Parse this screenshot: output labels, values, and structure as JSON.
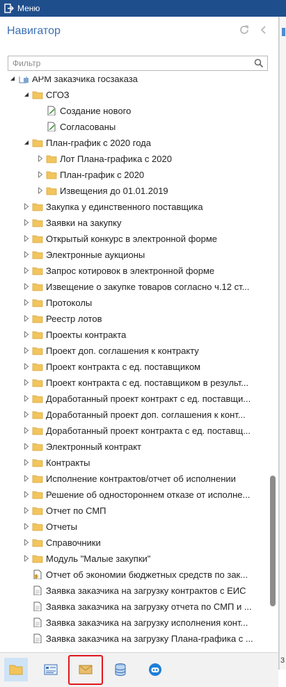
{
  "window": {
    "title": "Меню"
  },
  "navigator": {
    "title": "Навигатор",
    "filter_placeholder": "Фильтр"
  },
  "tree": [
    {
      "label": "АРМ заказчика госзаказа",
      "level": 0,
      "icon": "doc-folder",
      "expander": "expanded"
    },
    {
      "label": "СГОЗ",
      "level": 1,
      "icon": "folder",
      "expander": "expanded"
    },
    {
      "label": "Создание нового",
      "level": 2,
      "icon": "document-edit",
      "expander": "none"
    },
    {
      "label": "Согласованы",
      "level": 2,
      "icon": "document-edit",
      "expander": "none"
    },
    {
      "label": "План-график с 2020 года",
      "level": 1,
      "icon": "folder",
      "expander": "expanded"
    },
    {
      "label": "Лот Плана-графика с 2020",
      "level": 2,
      "icon": "folder",
      "expander": "collapsed"
    },
    {
      "label": "План-график с 2020",
      "level": 2,
      "icon": "folder",
      "expander": "collapsed"
    },
    {
      "label": "Извещения до 01.01.2019",
      "level": 2,
      "icon": "folder",
      "expander": "collapsed"
    },
    {
      "label": "Закупка у единственного поставщика",
      "level": 1,
      "icon": "folder",
      "expander": "collapsed"
    },
    {
      "label": "Заявки на закупку",
      "level": 1,
      "icon": "folder",
      "expander": "collapsed"
    },
    {
      "label": "Открытый конкурс в электронной форме",
      "level": 1,
      "icon": "folder",
      "expander": "collapsed"
    },
    {
      "label": "Электронные аукционы",
      "level": 1,
      "icon": "folder",
      "expander": "collapsed"
    },
    {
      "label": "Запрос котировок в электронной форме",
      "level": 1,
      "icon": "folder",
      "expander": "collapsed"
    },
    {
      "label": "Извещение о закупке товаров согласно ч.12 ст...",
      "level": 1,
      "icon": "folder",
      "expander": "collapsed"
    },
    {
      "label": "Протоколы",
      "level": 1,
      "icon": "folder",
      "expander": "collapsed"
    },
    {
      "label": "Реестр лотов",
      "level": 1,
      "icon": "folder",
      "expander": "collapsed"
    },
    {
      "label": "Проекты контракта",
      "level": 1,
      "icon": "folder",
      "expander": "collapsed"
    },
    {
      "label": "Проект доп. соглашения к контракту",
      "level": 1,
      "icon": "folder",
      "expander": "collapsed"
    },
    {
      "label": "Проект контракта с ед. поставщиком",
      "level": 1,
      "icon": "folder",
      "expander": "collapsed"
    },
    {
      "label": "Проект контракта с ед. поставщиком в результ...",
      "level": 1,
      "icon": "folder",
      "expander": "collapsed"
    },
    {
      "label": "Доработанный проект контракт с ед. поставщи...",
      "level": 1,
      "icon": "folder",
      "expander": "collapsed"
    },
    {
      "label": "Доработанный проект доп. соглашения к конт...",
      "level": 1,
      "icon": "folder",
      "expander": "collapsed"
    },
    {
      "label": "Доработанный проект контракта с ед. поставщ...",
      "level": 1,
      "icon": "folder",
      "expander": "collapsed"
    },
    {
      "label": "Электронный контракт",
      "level": 1,
      "icon": "folder",
      "expander": "collapsed"
    },
    {
      "label": "Контракты",
      "level": 1,
      "icon": "folder",
      "expander": "collapsed"
    },
    {
      "label": "Исполнение контрактов/отчет об исполнении",
      "level": 1,
      "icon": "folder",
      "expander": "collapsed"
    },
    {
      "label": "Решение об одностороннем отказе от исполне...",
      "level": 1,
      "icon": "folder",
      "expander": "collapsed"
    },
    {
      "label": "Отчет по СМП",
      "level": 1,
      "icon": "folder",
      "expander": "collapsed"
    },
    {
      "label": "Отчеты",
      "level": 1,
      "icon": "folder",
      "expander": "collapsed"
    },
    {
      "label": "Справочники",
      "level": 1,
      "icon": "folder",
      "expander": "collapsed"
    },
    {
      "label": "Модуль \"Малые закупки\"",
      "level": 1,
      "icon": "folder",
      "expander": "collapsed"
    },
    {
      "label": "Отчет об экономии бюджетных средств по зак...",
      "level": 1,
      "icon": "report",
      "expander": "none"
    },
    {
      "label": "Заявка заказчика на загрузку контрактов с ЕИС",
      "level": 1,
      "icon": "document",
      "expander": "none"
    },
    {
      "label": "Заявка заказчика на загрузку отчета по СМП и ...",
      "level": 1,
      "icon": "document",
      "expander": "none"
    },
    {
      "label": "Заявка заказчика на загрузку исполнения конт...",
      "level": 1,
      "icon": "document",
      "expander": "none"
    },
    {
      "label": "Заявка заказчика на загрузку Плана-графика с ...",
      "level": 1,
      "icon": "document",
      "expander": "none"
    }
  ],
  "bottom_toolbar": [
    {
      "name": "folder-tab-button",
      "icon": "folder-icon",
      "active": true
    },
    {
      "name": "list-tab-button",
      "icon": "list-card-icon",
      "active": false
    },
    {
      "name": "mail-tab-button",
      "icon": "envelope-icon",
      "active": false,
      "highlighted": true
    },
    {
      "name": "database-tab-button",
      "icon": "database-icon",
      "active": false
    },
    {
      "name": "assistant-tab-button",
      "icon": "robot-icon",
      "active": false
    }
  ],
  "right_panel": {
    "counter": "3"
  },
  "colors": {
    "titlebar": "#1f4e8c",
    "accent": "#3a6fb4",
    "folder": "#f2c55c",
    "highlight": "#e0161c"
  }
}
